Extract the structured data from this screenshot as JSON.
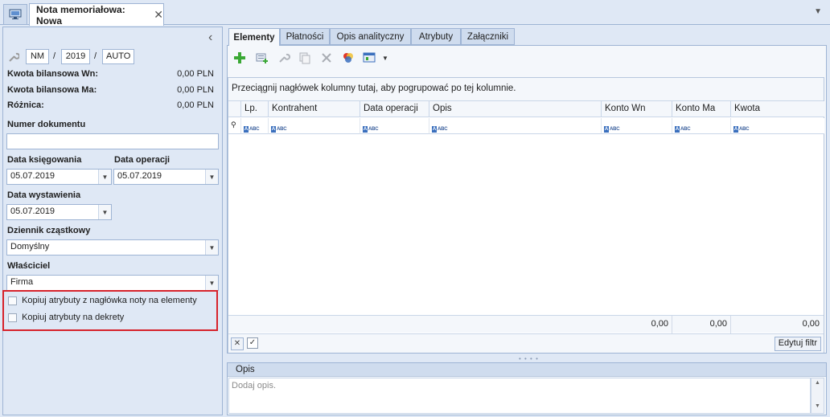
{
  "window": {
    "tab_title": "Nota memoriałowa: Nowa",
    "close_glyph": "✕",
    "menu_glyph": "▼"
  },
  "header": {
    "collapse_glyph": "‹",
    "series": "NM",
    "year": "2019",
    "number": "AUTO",
    "sep1": "/",
    "sep2": "/"
  },
  "summary": [
    {
      "label": "Kwota bilansowa Wn:",
      "value": "0,00 PLN"
    },
    {
      "label": "Kwota bilansowa Ma:",
      "value": "0,00 PLN"
    },
    {
      "label": "Różnica:",
      "value": "0,00 PLN"
    }
  ],
  "form": {
    "numer_dokumentu": {
      "label": "Numer dokumentu",
      "value": ""
    },
    "data_ksiegowania": {
      "label": "Data księgowania",
      "value": "05.07.2019"
    },
    "data_operacji": {
      "label": "Data operacji",
      "value": "05.07.2019"
    },
    "data_wystawienia": {
      "label": "Data wystawienia",
      "value": "05.07.2019"
    },
    "dziennik": {
      "label": "Dziennik cząstkowy",
      "value": "Domyślny"
    },
    "wlasciciel": {
      "label": "Właściciel",
      "value": "Firma"
    },
    "kopiuj_naglowek": {
      "label": "Kopiuj atrybuty z nagłówka noty na elementy",
      "checked": false
    },
    "kopiuj_dekrety": {
      "label": "Kopiuj atrybuty na dekrety",
      "checked": false
    }
  },
  "tabs": [
    "Elementy",
    "Płatności",
    "Opis analityczny",
    "Atrybuty",
    "Załączniki"
  ],
  "active_tab": "Elementy",
  "toolbar_icons": [
    "add-icon",
    "add-from-list-icon",
    "edit-wrench-icon",
    "copy-icon",
    "delete-icon",
    "color-icon",
    "view-dropdown-icon"
  ],
  "grid": {
    "group_hint": "Przeciągnij nagłówek kolumny tutaj, aby pogrupować po tej kolumnie.",
    "columns": [
      "Lp.",
      "Kontrahent",
      "Data operacji",
      "Opis",
      "Konto Wn",
      "Konto Ma",
      "Kwota"
    ],
    "filter_glyph": "ABC",
    "sums": {
      "konto_wn": "0,00",
      "konto_ma": "0,00",
      "kwota": "0,00"
    },
    "edit_filter_label": "Edytuj filtr"
  },
  "opis": {
    "title": "Opis",
    "placeholder": "Dodaj opis."
  },
  "colors": {
    "accent_border": "#9eb4d4",
    "panel_bg": "#dfe8f5",
    "highlight": "#d7222b",
    "add_green": "#3aa835"
  }
}
